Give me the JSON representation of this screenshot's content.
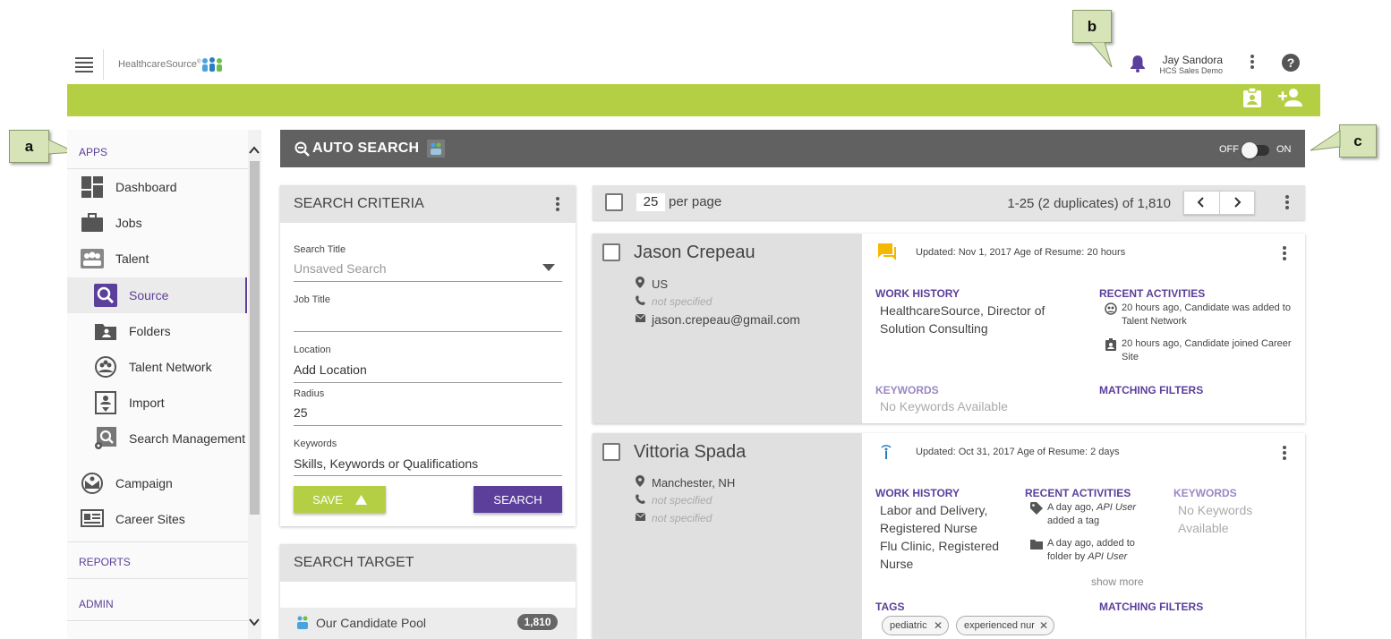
{
  "header": {
    "brand": "HealthcareSource",
    "brand_mark": "®",
    "user_name": "Jay Sandora",
    "user_org": "HCS Sales Demo"
  },
  "callouts": {
    "a": "a",
    "b": "b",
    "c": "c"
  },
  "sidebar": {
    "apps_label": "APPS",
    "items": [
      {
        "label": "Dashboard",
        "icon": "dashboard-icon"
      },
      {
        "label": "Jobs",
        "icon": "briefcase-icon"
      },
      {
        "label": "Talent",
        "icon": "people-icon"
      },
      {
        "label": "Source",
        "icon": "search-icon"
      },
      {
        "label": "Folders",
        "icon": "folder-icon"
      },
      {
        "label": "Talent Network",
        "icon": "network-icon"
      },
      {
        "label": "Import",
        "icon": "import-icon"
      },
      {
        "label": "Search Management",
        "icon": "search-gear-icon"
      },
      {
        "label": "Campaign",
        "icon": "campaign-icon"
      },
      {
        "label": "Career Sites",
        "icon": "career-sites-icon"
      }
    ],
    "reports_label": "REPORTS",
    "admin_label": "ADMIN"
  },
  "auto_search": {
    "title": "AUTO SEARCH",
    "toggle_off": "OFF",
    "toggle_on": "ON",
    "toggle_state": "off"
  },
  "criteria": {
    "title": "SEARCH CRITERIA",
    "search_title_label": "Search Title",
    "search_title_value": "Unsaved Search",
    "job_title_label": "Job Title",
    "job_title_value": "",
    "location_label": "Location",
    "location_value": "Add Location",
    "radius_label": "Radius",
    "radius_value": "25",
    "keywords_label": "Keywords",
    "keywords_value": "Skills, Keywords or Qualifications",
    "save_label": "SAVE",
    "search_label": "SEARCH"
  },
  "target": {
    "title": "SEARCH TARGET",
    "pool_label": "Our Candidate Pool",
    "pool_count": "1,810"
  },
  "results": {
    "per_page_value": "25",
    "per_page_label": "per page",
    "summary": "1-25 (2 duplicates) of 1,810"
  },
  "candidates": [
    {
      "name": "Jason Crepeau",
      "location": "US",
      "phone": "not specified",
      "email": "jason.crepeau@gmail.com",
      "updated": "Updated: Nov 1, 2017  Age of Resume: 20 hours",
      "work_history_label": "WORK HISTORY",
      "work_history": [
        "HealthcareSource, Director of",
        "Solution Consulting"
      ],
      "recent_label": "RECENT ACTIVITIES",
      "activities": [
        {
          "lines": [
            "20 hours ago, Candidate was added to",
            "Talent Network"
          ]
        },
        {
          "lines": [
            "20 hours ago, Candidate joined Career",
            "Site"
          ]
        }
      ],
      "keywords_label": "KEYWORDS",
      "keywords": "No Keywords Available",
      "matching_label": "MATCHING FILTERS"
    },
    {
      "name": "Vittoria Spada",
      "location": "Manchester, NH",
      "phone": "not specified",
      "email": "not specified",
      "updated": "Updated: Oct 31, 2017  Age of Resume: 2 days",
      "work_history_label": "WORK HISTORY",
      "work_history": [
        "Labor and Delivery,",
        "Registered Nurse",
        "Flu Clinic, Registered",
        "Nurse"
      ],
      "recent_label": "RECENT ACTIVITIES",
      "activities": [
        {
          "l1_pre": "A day ago, ",
          "l1_em": "API User",
          "l2": "added a tag"
        },
        {
          "l1": "A day ago, added to",
          "l2_pre": "folder by ",
          "l2_em": "API User"
        }
      ],
      "show_more": "show more",
      "keywords_label": "KEYWORDS",
      "keywords": [
        "No Keywords",
        "Available"
      ],
      "tags_label": "TAGS",
      "tags": [
        "pediatric",
        "experienced nur"
      ],
      "matching_label": "MATCHING FILTERS"
    }
  ]
}
